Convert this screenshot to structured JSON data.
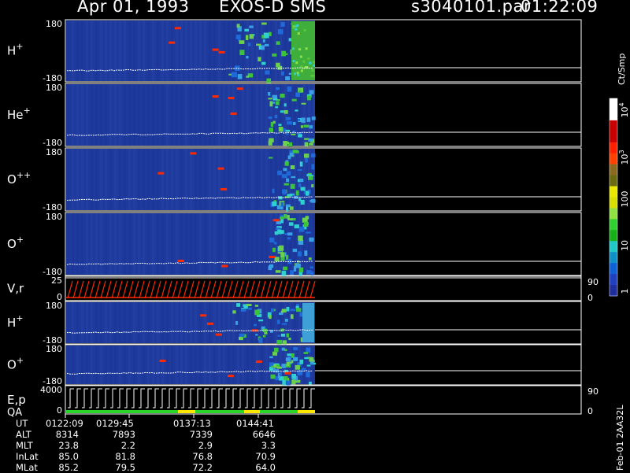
{
  "header": {
    "date": "Apr 01, 1993",
    "mission": "EXOS-D SMS",
    "file": "s3040101.par",
    "time": "01:22:09"
  },
  "colorbar": {
    "title": "Ct/Smp",
    "ticks": [
      "10",
      "10",
      "100",
      "10",
      "10",
      "1"
    ],
    "ticks_full": [
      "10^4",
      "10^3",
      "100",
      "10",
      "1"
    ]
  },
  "dump_label": "Feb-01 2AA32L",
  "ephemeris": {
    "row_labels": [
      "UT",
      "ALT",
      "MLT",
      "InLat",
      "MLat"
    ],
    "columns": [
      [
        "0122:09",
        "8314",
        "23.8",
        "85.0",
        "85.2"
      ],
      [
        "0129:45",
        "7893",
        "2.2",
        "81.8",
        "79.5"
      ],
      [
        "0137:13",
        "7339",
        "2.9",
        "76.8",
        "72.2"
      ],
      [
        "0144:41",
        "6646",
        "3.3",
        "70.9",
        "64.0"
      ]
    ]
  },
  "chart_data": {
    "type": "heatmap",
    "title": "Apr 01, 1993   EXOS-D SMS",
    "x_ticks_ut": [
      "0122:09",
      "0129:45",
      "0137:13",
      "0144:41"
    ],
    "colorbar_range": [
      1,
      10000
    ],
    "colorbar_log": true,
    "panels": [
      {
        "name": "H+",
        "label_base": "H",
        "label_sup": "+",
        "ylim": [
          -180,
          180
        ],
        "yticks": [
          "180",
          "-180"
        ],
        "type": "spectrogram"
      },
      {
        "name": "He+",
        "label_base": "He",
        "label_sup": "+",
        "ylim": [
          -180,
          180
        ],
        "yticks": [
          "180",
          "-180"
        ],
        "type": "spectrogram"
      },
      {
        "name": "O++",
        "label_base": "O",
        "label_sup": "++",
        "ylim": [
          -180,
          180
        ],
        "yticks": [
          "180",
          "-180"
        ],
        "type": "spectrogram"
      },
      {
        "name": "O+",
        "label_base": "O",
        "label_sup": "+",
        "ylim": [
          -180,
          180
        ],
        "yticks": [
          "180",
          "-180"
        ],
        "type": "spectrogram"
      },
      {
        "name": "V,r",
        "label_base": "V,r",
        "label_sup": "",
        "ylim": [
          0,
          25
        ],
        "yticks": [
          "25",
          "0"
        ],
        "right_ticks": [
          "90",
          "0"
        ],
        "type": "sweep"
      },
      {
        "name": "H+",
        "label_base": "H",
        "label_sup": "+",
        "ylim": [
          -180,
          180
        ],
        "yticks": [
          "180",
          "-180"
        ],
        "type": "spectrogram"
      },
      {
        "name": "O+",
        "label_base": "O",
        "label_sup": "+",
        "ylim": [
          -180,
          180
        ],
        "yticks": [
          "180",
          "-180"
        ],
        "type": "spectrogram"
      },
      {
        "name": "E,p QA",
        "label_base": "E,p",
        "label_line2": "QA",
        "label_sup": "",
        "ylim": [
          0,
          4000
        ],
        "yticks": [
          "4000",
          "0"
        ],
        "right_ticks": [
          "90",
          "0"
        ],
        "type": "sweep"
      }
    ]
  },
  "colors": {
    "background": "#000000",
    "spectrogram_bg": "#1e3a9c",
    "axis": "#ffffff",
    "sweep": "#ff2a00",
    "qa_green": "#2bd62b",
    "qa_yellow": "#ffe600"
  }
}
